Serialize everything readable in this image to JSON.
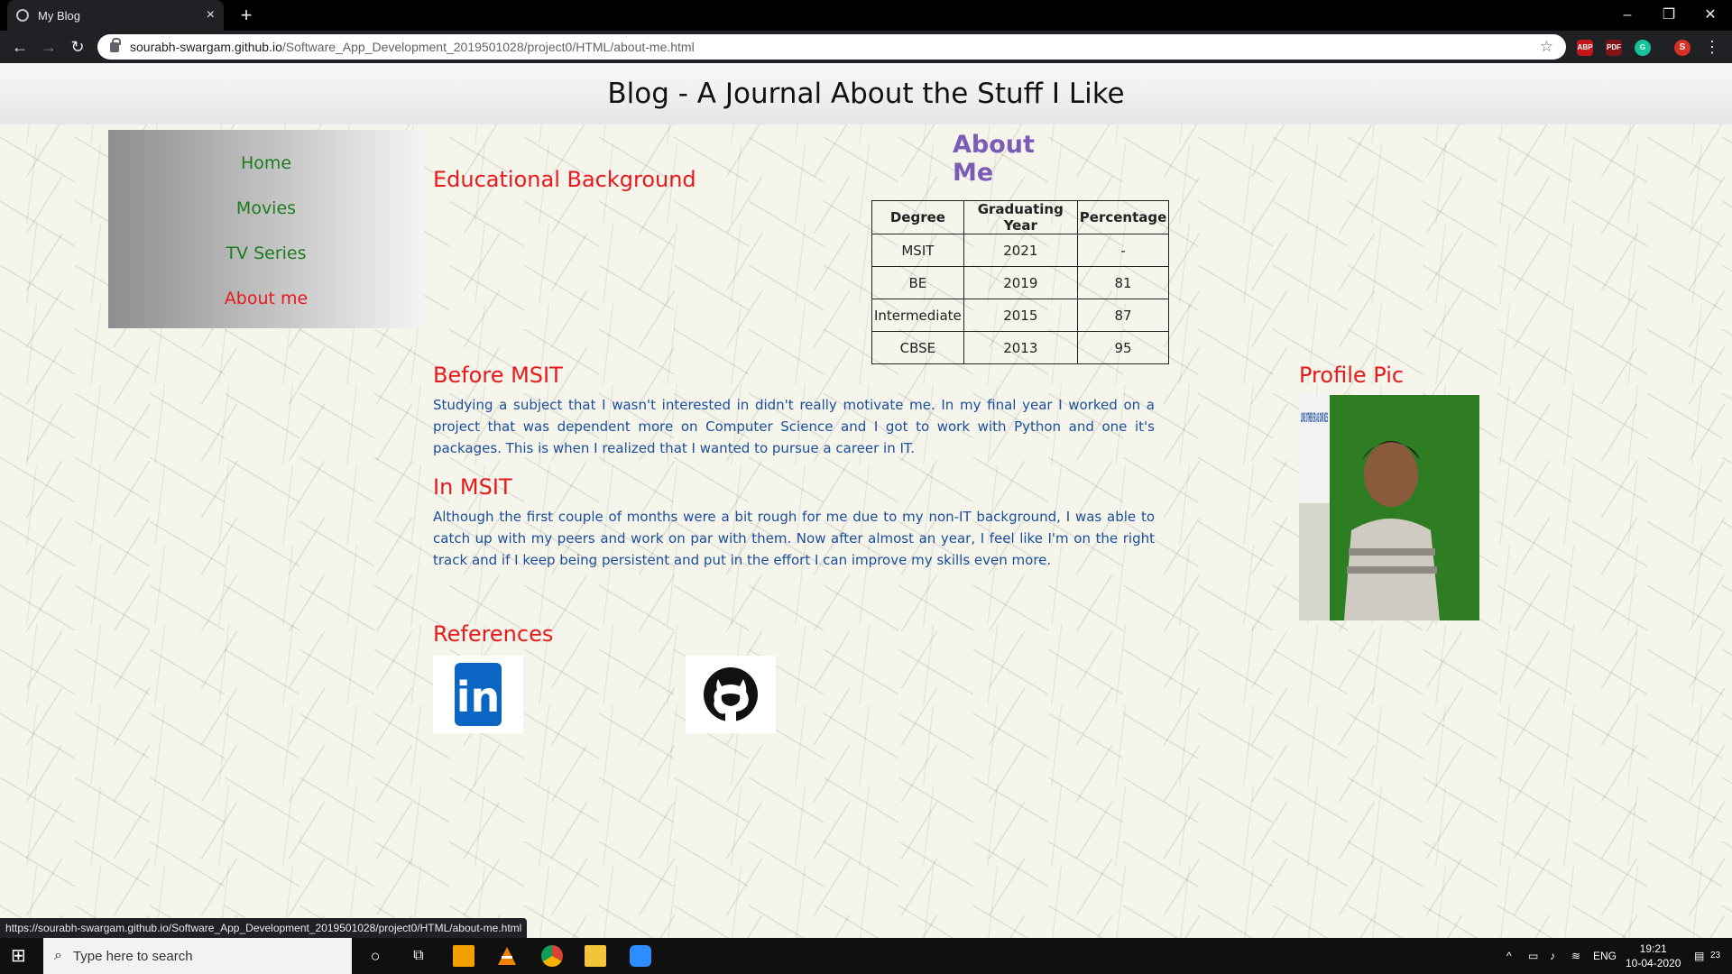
{
  "browser": {
    "tab_title": "My Blog",
    "tab_close": "×",
    "new_tab": "+",
    "url_host": "sourabh-swargam.github.io",
    "url_path": "/Software_App_Development_2019501028/project0/HTML/about-me.html",
    "window_controls": {
      "minimize": "–",
      "restore": "❐",
      "close": "✕"
    },
    "nav": {
      "back": "←",
      "forward": "→",
      "reload": "↻"
    },
    "extensions": [
      "ABP",
      "PDF",
      "G",
      "S"
    ],
    "status_url": "https://sourabh-swargam.github.io/Software_App_Development_2019501028/project0/HTML/about-me.html"
  },
  "site": {
    "header_title": "Blog - A Journal About the Stuff I Like",
    "nav": [
      "Home",
      "Movies",
      "TV Series",
      "About me"
    ],
    "active_nav": "About me"
  },
  "about": {
    "title": "About Me",
    "edu_heading": "Educational Background",
    "table": {
      "headers": [
        "Degree",
        "Graduating Year",
        "Percentage"
      ],
      "rows": [
        [
          "MSIT",
          "2021",
          "-"
        ],
        [
          "BE",
          "2019",
          "81"
        ],
        [
          "Intermediate",
          "2015",
          "87"
        ],
        [
          "CBSE",
          "2013",
          "95"
        ]
      ]
    },
    "before_heading": "Before MSIT",
    "before_text": "Studying a subject that I wasn't interested in didn't really motivate me. In my final year I worked on a project that was dependent more on Computer Science and I got to work with Python and one it's packages. This is when I realized that I wanted to pursue a career in IT.",
    "in_heading": "In MSIT",
    "in_text": "Although the first couple of months were a bit rough for me due to my non-IT background, I was able to catch up with my peers and work on par with them. Now after almost an year, I feel like I'm on the right track and if I keep being persistent and put in the effort I can improve my skills even more.",
    "profile_heading": "Profile Pic",
    "poster_text": "LOVE OTHER ER AS OUR KES",
    "references_heading": "References",
    "linkedin_text": "in"
  },
  "taskbar": {
    "search_placeholder": "Type here to search",
    "time": "19:21",
    "date": "10-04-2020",
    "lang": "ENG",
    "notifications": "23"
  },
  "colors": {
    "heading_red": "#e8191b",
    "nav_green": "#1d7a1d",
    "about_purple": "#7b5bb5",
    "body_blue": "#1b4e9a"
  }
}
